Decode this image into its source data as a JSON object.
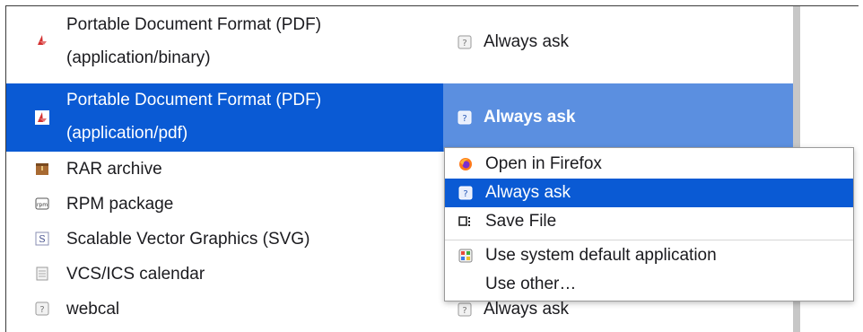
{
  "colors": {
    "selection": "#0a5ad4",
    "selection_action": "#5b8fe0",
    "text": "#1b1b1f",
    "scrollbar": "#c7c7c7"
  },
  "rows": [
    {
      "type_line1": "Portable Document Format (PDF)",
      "type_line2": "(application/binary)",
      "icon": "pdf-icon",
      "action": "Always ask",
      "action_icon": "question-icon"
    },
    {
      "type_line1": "Portable Document Format (PDF)",
      "type_line2": "(application/pdf)",
      "icon": "pdf-icon",
      "action": "Always ask",
      "action_icon": "question-icon",
      "selected": true
    },
    {
      "type": "RAR archive",
      "icon": "archive-icon"
    },
    {
      "type": "RPM package",
      "icon": "rpm-icon"
    },
    {
      "type": "Scalable Vector Graphics (SVG)",
      "icon": "svg-icon"
    },
    {
      "type": "VCS/ICS calendar",
      "icon": "calendar-icon"
    },
    {
      "type": "webcal",
      "icon": "question-icon",
      "action": "Always ask",
      "action_icon": "question-icon"
    }
  ],
  "menu": {
    "items": [
      {
        "label": "Open in Firefox",
        "icon": "firefox-icon"
      },
      {
        "label": "Always ask",
        "icon": "question-icon",
        "selected": true
      },
      {
        "label": "Save File",
        "icon": "save-file-icon"
      },
      {
        "label": "Use system default application",
        "icon": "system-app-icon"
      },
      {
        "label": "Use other…",
        "icon": ""
      }
    ]
  }
}
